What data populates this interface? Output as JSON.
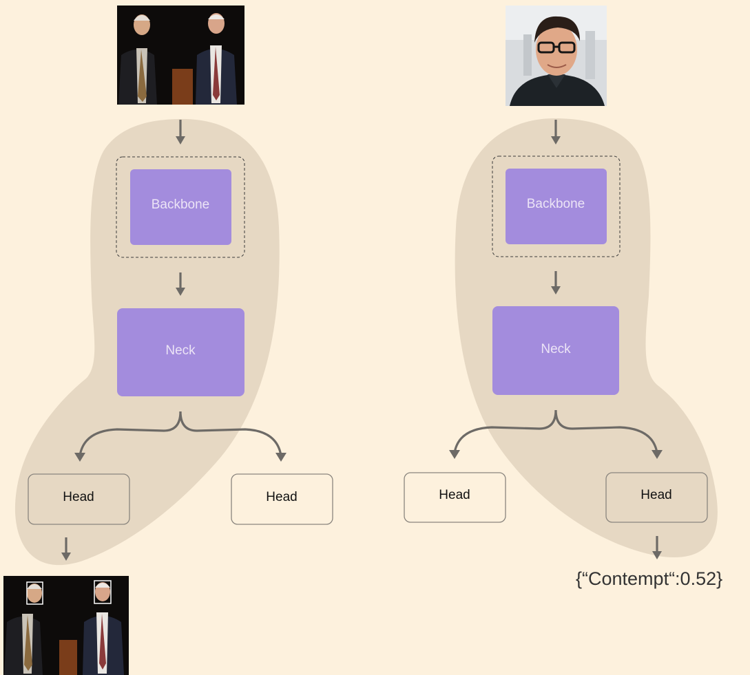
{
  "left_pipeline": {
    "backbone_label": "Backbone",
    "neck_label": "Neck",
    "head_left_label": "Head",
    "head_right_label": "Head",
    "active_head": "left",
    "input_image": "two-men-on-stage-photo",
    "output_image": "two-men-with-face-detection-boxes-photo"
  },
  "right_pipeline": {
    "backbone_label": "Backbone",
    "neck_label": "Neck",
    "head_left_label": "Head",
    "head_right_label": "Head",
    "active_head": "right",
    "input_image": "man-with-glasses-portrait-photo",
    "output_text": "{“Contempt“:0.52}"
  },
  "colors": {
    "background": "#fdf1dd",
    "blob": "#e6d8c3",
    "module": "#a38cdd",
    "arrow": "#6d6a66",
    "head_border": "#8a857e"
  }
}
